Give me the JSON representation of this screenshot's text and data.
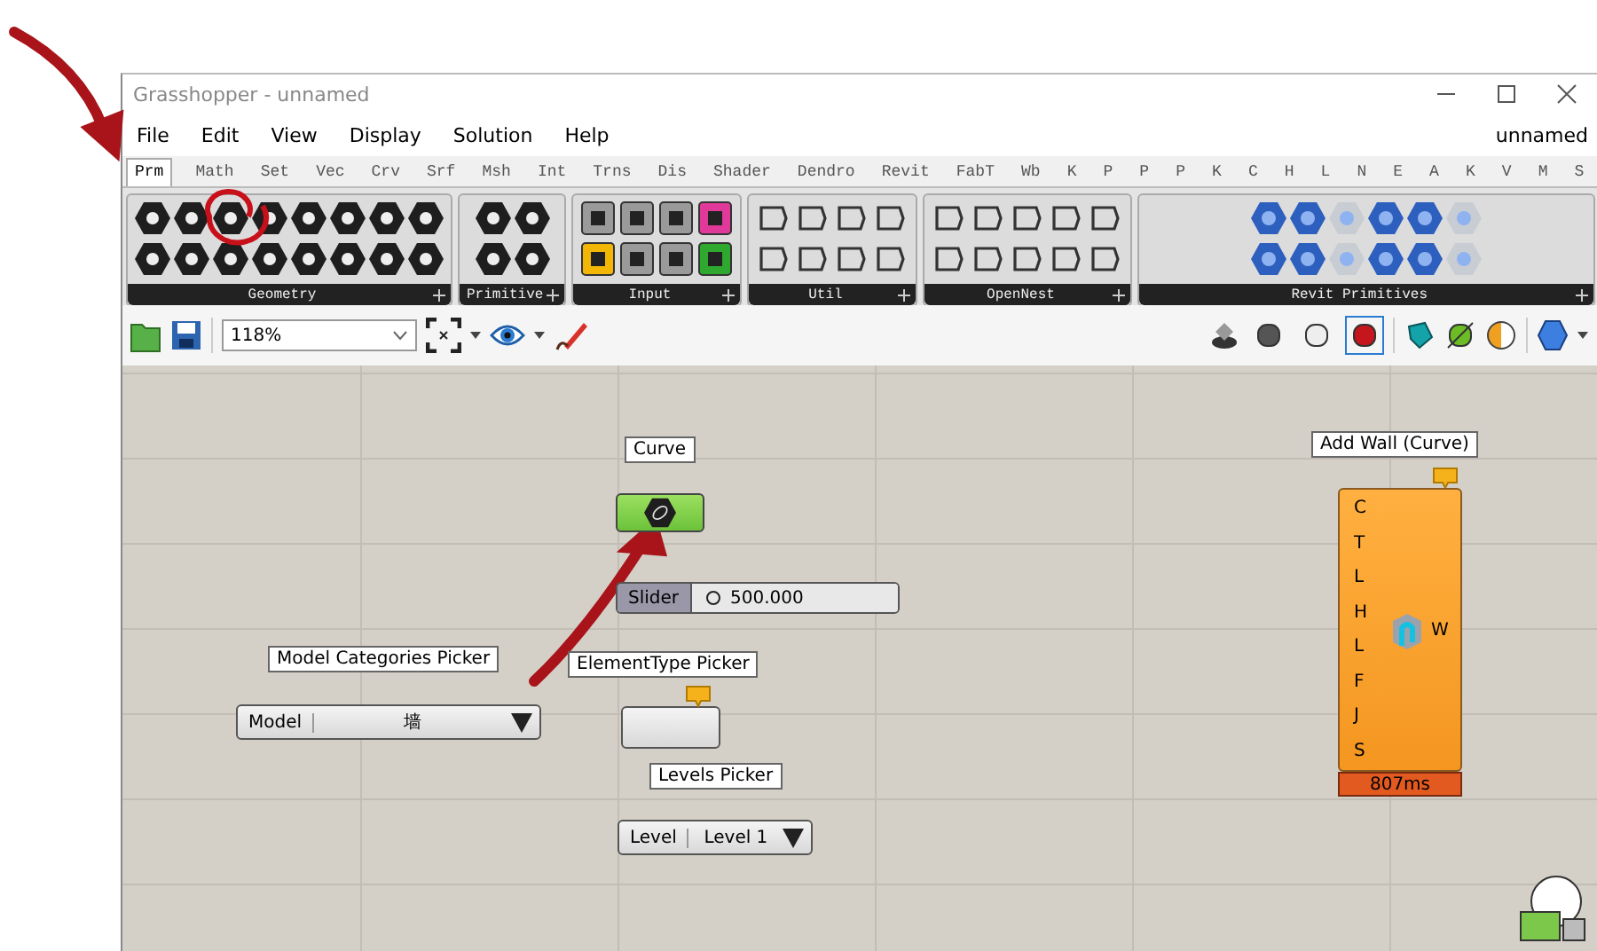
{
  "window": {
    "title": "Grasshopper - unnamed"
  },
  "menu": {
    "items": [
      "File",
      "Edit",
      "View",
      "Display",
      "Solution",
      "Help"
    ],
    "document": "unnamed"
  },
  "tabs": [
    {
      "label": "Prm",
      "selected": true
    },
    {
      "label": "Math",
      "selected": false
    },
    {
      "label": "Set",
      "selected": false
    },
    {
      "label": "Vec",
      "selected": false
    },
    {
      "label": "Crv",
      "selected": false
    },
    {
      "label": "Srf",
      "selected": false
    },
    {
      "label": "Msh",
      "selected": false
    },
    {
      "label": "Int",
      "selected": false
    },
    {
      "label": "Trns",
      "selected": false
    },
    {
      "label": "Dis",
      "selected": false
    },
    {
      "label": "Shader",
      "selected": false
    },
    {
      "label": "Dendro",
      "selected": false
    },
    {
      "label": "Revit",
      "selected": false
    },
    {
      "label": "FabT",
      "selected": false
    },
    {
      "label": "Wb",
      "selected": false
    },
    {
      "label": "K",
      "selected": false
    },
    {
      "label": "P",
      "selected": false
    },
    {
      "label": "P",
      "selected": false
    },
    {
      "label": "P",
      "selected": false
    },
    {
      "label": "K",
      "selected": false
    },
    {
      "label": "C",
      "selected": false
    },
    {
      "label": "H",
      "selected": false
    },
    {
      "label": "L",
      "selected": false
    },
    {
      "label": "N",
      "selected": false
    },
    {
      "label": "E",
      "selected": false
    },
    {
      "label": "A",
      "selected": false
    },
    {
      "label": "K",
      "selected": false
    },
    {
      "label": "V",
      "selected": false
    },
    {
      "label": "M",
      "selected": false
    },
    {
      "label": "S",
      "selected": false
    }
  ],
  "ribbon": [
    {
      "label": "Geometry"
    },
    {
      "label": "Primitive"
    },
    {
      "label": "Input"
    },
    {
      "label": "Util"
    },
    {
      "label": "OpenNest"
    },
    {
      "label": "Revit Primitives"
    }
  ],
  "toolbar": {
    "zoom": "118%",
    "preview_modes": [
      {
        "selected": false
      },
      {
        "selected": false
      },
      {
        "selected": true
      }
    ]
  },
  "canvas": {
    "curve": {
      "label": "Curve"
    },
    "slider": {
      "name": "Slider",
      "value": "500.000",
      "level": 0.04
    },
    "pickers": [
      {
        "label": "Model Categories Picker",
        "kind": "dropdown",
        "name": "Model",
        "value": "墙",
        "warning": false
      },
      {
        "label": "ElementType Picker",
        "kind": "empty",
        "warning": true
      },
      {
        "label": "Levels Picker",
        "kind": "dropdown",
        "name": "Level",
        "value": "Level 1",
        "warning": false
      }
    ],
    "component": {
      "label": "Add Wall (Curve)",
      "inputs": [
        "C",
        "T",
        "L",
        "H",
        "L",
        "F",
        "J",
        "S"
      ],
      "output": "W",
      "time": "807ms",
      "warning": true
    }
  }
}
